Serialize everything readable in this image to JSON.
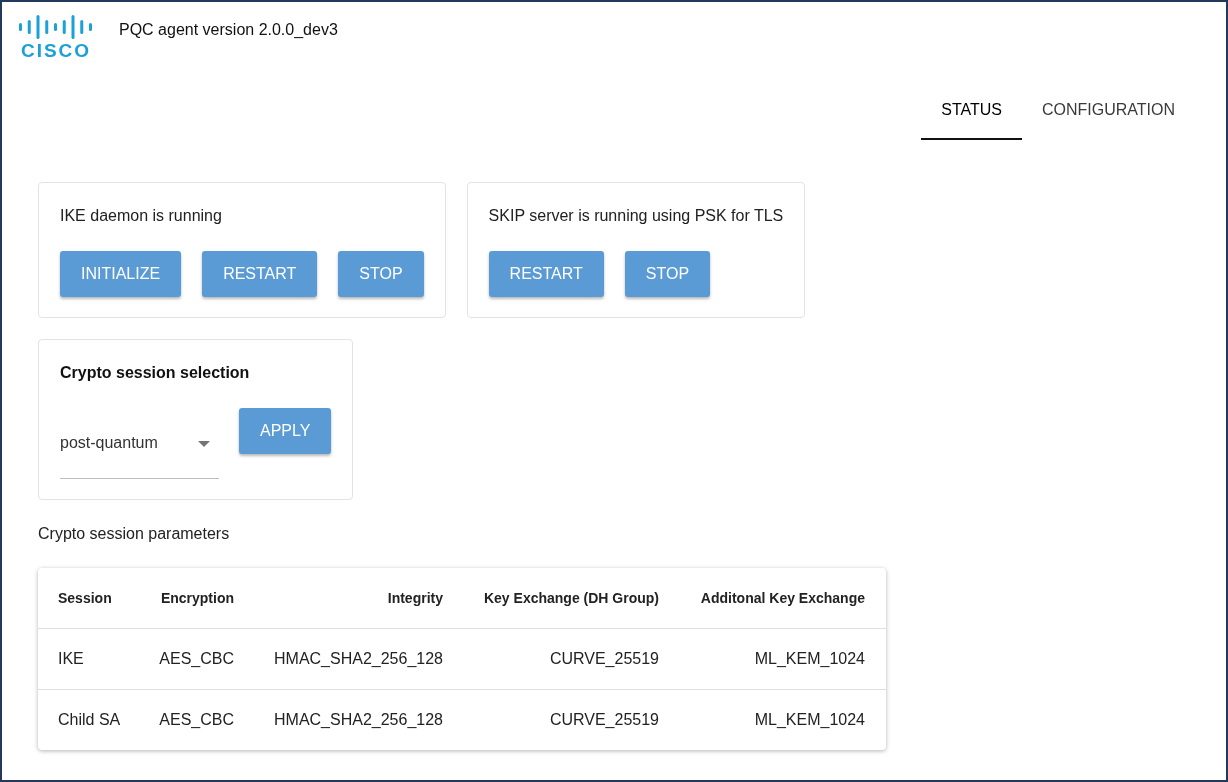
{
  "header": {
    "logo_text": "CISCO",
    "title": "PQC agent version 2.0.0_dev3"
  },
  "tabs": [
    {
      "label": "STATUS",
      "selected": true
    },
    {
      "label": "CONFIGURATION",
      "selected": false
    }
  ],
  "service_cards": [
    {
      "status": "IKE daemon is running",
      "buttons": [
        "INITIALIZE",
        "RESTART",
        "STOP"
      ]
    },
    {
      "status": "SKIP server is running using PSK for TLS",
      "buttons": [
        "RESTART",
        "STOP"
      ]
    }
  ],
  "session_selection": {
    "title": "Crypto session selection",
    "value": "post-quantum",
    "button": "APPLY"
  },
  "session_parameters": {
    "title": "Crypto session parameters",
    "columns": [
      "Session",
      "Encryption",
      "Integrity",
      "Key Exchange (DH Group)",
      "Additonal Key Exchange"
    ],
    "rows": [
      [
        "IKE",
        "AES_CBC",
        "HMAC_SHA2_256_128",
        "CURVE_25519",
        "ML_KEM_1024"
      ],
      [
        "Child SA",
        "AES_CBC",
        "HMAC_SHA2_256_128",
        "CURVE_25519",
        "ML_KEM_1024"
      ]
    ]
  }
}
